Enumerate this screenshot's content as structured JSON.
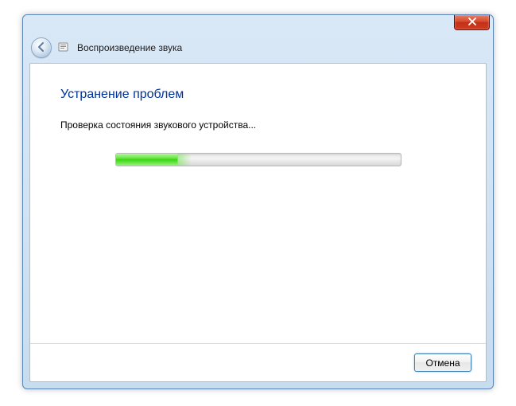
{
  "window": {
    "title": "Воспроизведение звука"
  },
  "content": {
    "heading": "Устранение проблем",
    "status": "Проверка состояния звукового устройства...",
    "progress_percent": 22
  },
  "footer": {
    "cancel_label": "Отмена"
  },
  "colors": {
    "heading": "#003399",
    "accent": "#3c7fb1",
    "close": "#c1321a",
    "progress": "#3fd518"
  }
}
